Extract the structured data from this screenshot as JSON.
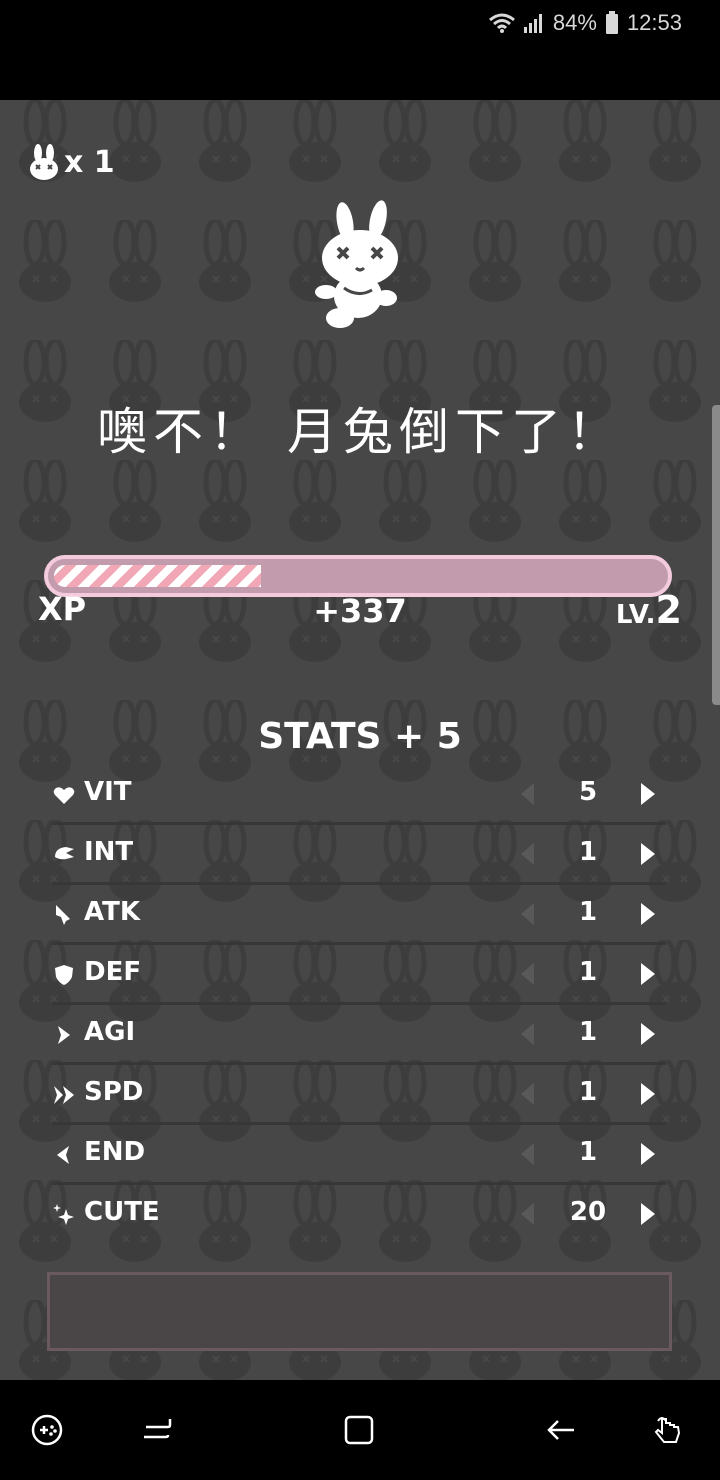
{
  "status_bar": {
    "battery_percent": "84%",
    "time": "12:53",
    "icons": [
      "wifi-icon",
      "cell-signal-icon",
      "battery-icon"
    ]
  },
  "game_over": {
    "lives_count": "x 1",
    "title": "噢不！ 月兔倒下了！",
    "xp": {
      "label": "XP",
      "gain": "+337",
      "level_prefix": "LV.",
      "level_number": "2",
      "progress_fraction": 0.34
    },
    "stats_header": "STATS + 5",
    "stats": [
      {
        "name": "VIT",
        "value": "5",
        "icon": "heart-icon"
      },
      {
        "name": "INT",
        "value": "1",
        "icon": "brain-icon"
      },
      {
        "name": "ATK",
        "value": "1",
        "icon": "sword-icon"
      },
      {
        "name": "DEF",
        "value": "1",
        "icon": "shield-icon"
      },
      {
        "name": "AGI",
        "value": "1",
        "icon": "chevron-icon"
      },
      {
        "name": "SPD",
        "value": "1",
        "icon": "double-chevron-icon"
      },
      {
        "name": "END",
        "value": "1",
        "icon": "back-chevron-icon"
      },
      {
        "name": "CUTE",
        "value": "20",
        "icon": "sparkle-icon"
      }
    ]
  },
  "nav_bar": {
    "buttons": [
      "game-tools-icon",
      "recents-icon",
      "home-icon",
      "back-icon",
      "assistive-touch-icon"
    ]
  },
  "colors": {
    "background": "#474747",
    "xp_border": "#f3cbdc",
    "xp_track": "#c29cad",
    "xp_stripe": "#f1a7b5"
  }
}
